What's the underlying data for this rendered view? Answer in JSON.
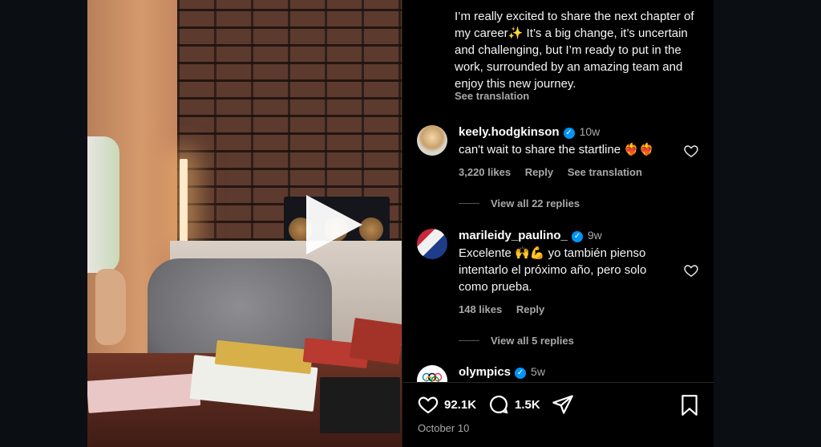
{
  "post": {
    "caption": "I’m really excited to share the next chapter of my career✨ It’s a big change, it’s uncertain and challenging, but I’m ready to put in the work, surrounded by an amazing team and enjoy this new journey.",
    "see_translation": "See translation",
    "date": "October 10"
  },
  "comments": [
    {
      "username": "keely.hodgkinson",
      "time": "10w",
      "text": "can't wait to share the startline ❤️‍🔥❤️‍🔥",
      "likes": "3,220 likes",
      "reply": "Reply",
      "see_translation": "See translation",
      "view_replies": "View all 22 replies"
    },
    {
      "username": "marileidy_paulino_",
      "time": "9w",
      "text": "Excelente 🙌💪  yo también pienso intentarlo el próximo año, pero solo como prueba.",
      "likes": "148 likes",
      "reply": "Reply",
      "view_replies": "View all 5 replies"
    },
    {
      "username": "olympics",
      "time": "5w"
    }
  ],
  "actions": {
    "likes_count": "92.1K",
    "comments_count": "1.5K"
  },
  "icons": [
    "play-icon",
    "verified-icon",
    "heart-icon",
    "comment-icon",
    "share-icon",
    "bookmark-icon"
  ],
  "colors": {
    "verified": "#0095f6",
    "muted": "#a8a8a8",
    "background": "#000000"
  }
}
